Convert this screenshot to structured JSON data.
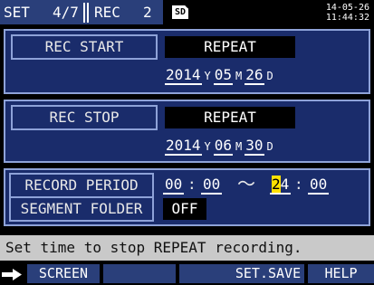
{
  "header": {
    "set_label": "SET",
    "set_page": "4/7",
    "rec_label": "REC",
    "rec_page": "2",
    "sd_label": "SD",
    "date": "14-05-26",
    "time": "11:44:32"
  },
  "rec_start": {
    "label": "REC START",
    "mode": "REPEAT",
    "year": "2014",
    "month": "05",
    "day": "26"
  },
  "rec_stop": {
    "label": "REC STOP",
    "mode": "REPEAT",
    "year": "2014",
    "month": "06",
    "day": "30"
  },
  "units": {
    "year": "Y",
    "month": "M",
    "day": "D"
  },
  "record_period": {
    "label": "RECORD PERIOD",
    "start_hour": "00",
    "start_min": "00",
    "tilde": "～",
    "end_hour_cursor": "2",
    "end_hour_rest": "4",
    "end_min": "00",
    "colon": ":"
  },
  "segment_folder": {
    "label": "SEGMENT FOLDER",
    "value": "OFF"
  },
  "status_message": "Set time to stop REPEAT recording.",
  "function_keys": {
    "screen": "SCREEN",
    "set_save": "SET.SAVE",
    "help": "HELP"
  },
  "colors": {
    "accent_blue": "#2a3f7a",
    "panel_blue": "#1a2c6b",
    "cursor_yellow": "#ffe000",
    "status_gray": "#c9c9c9"
  }
}
